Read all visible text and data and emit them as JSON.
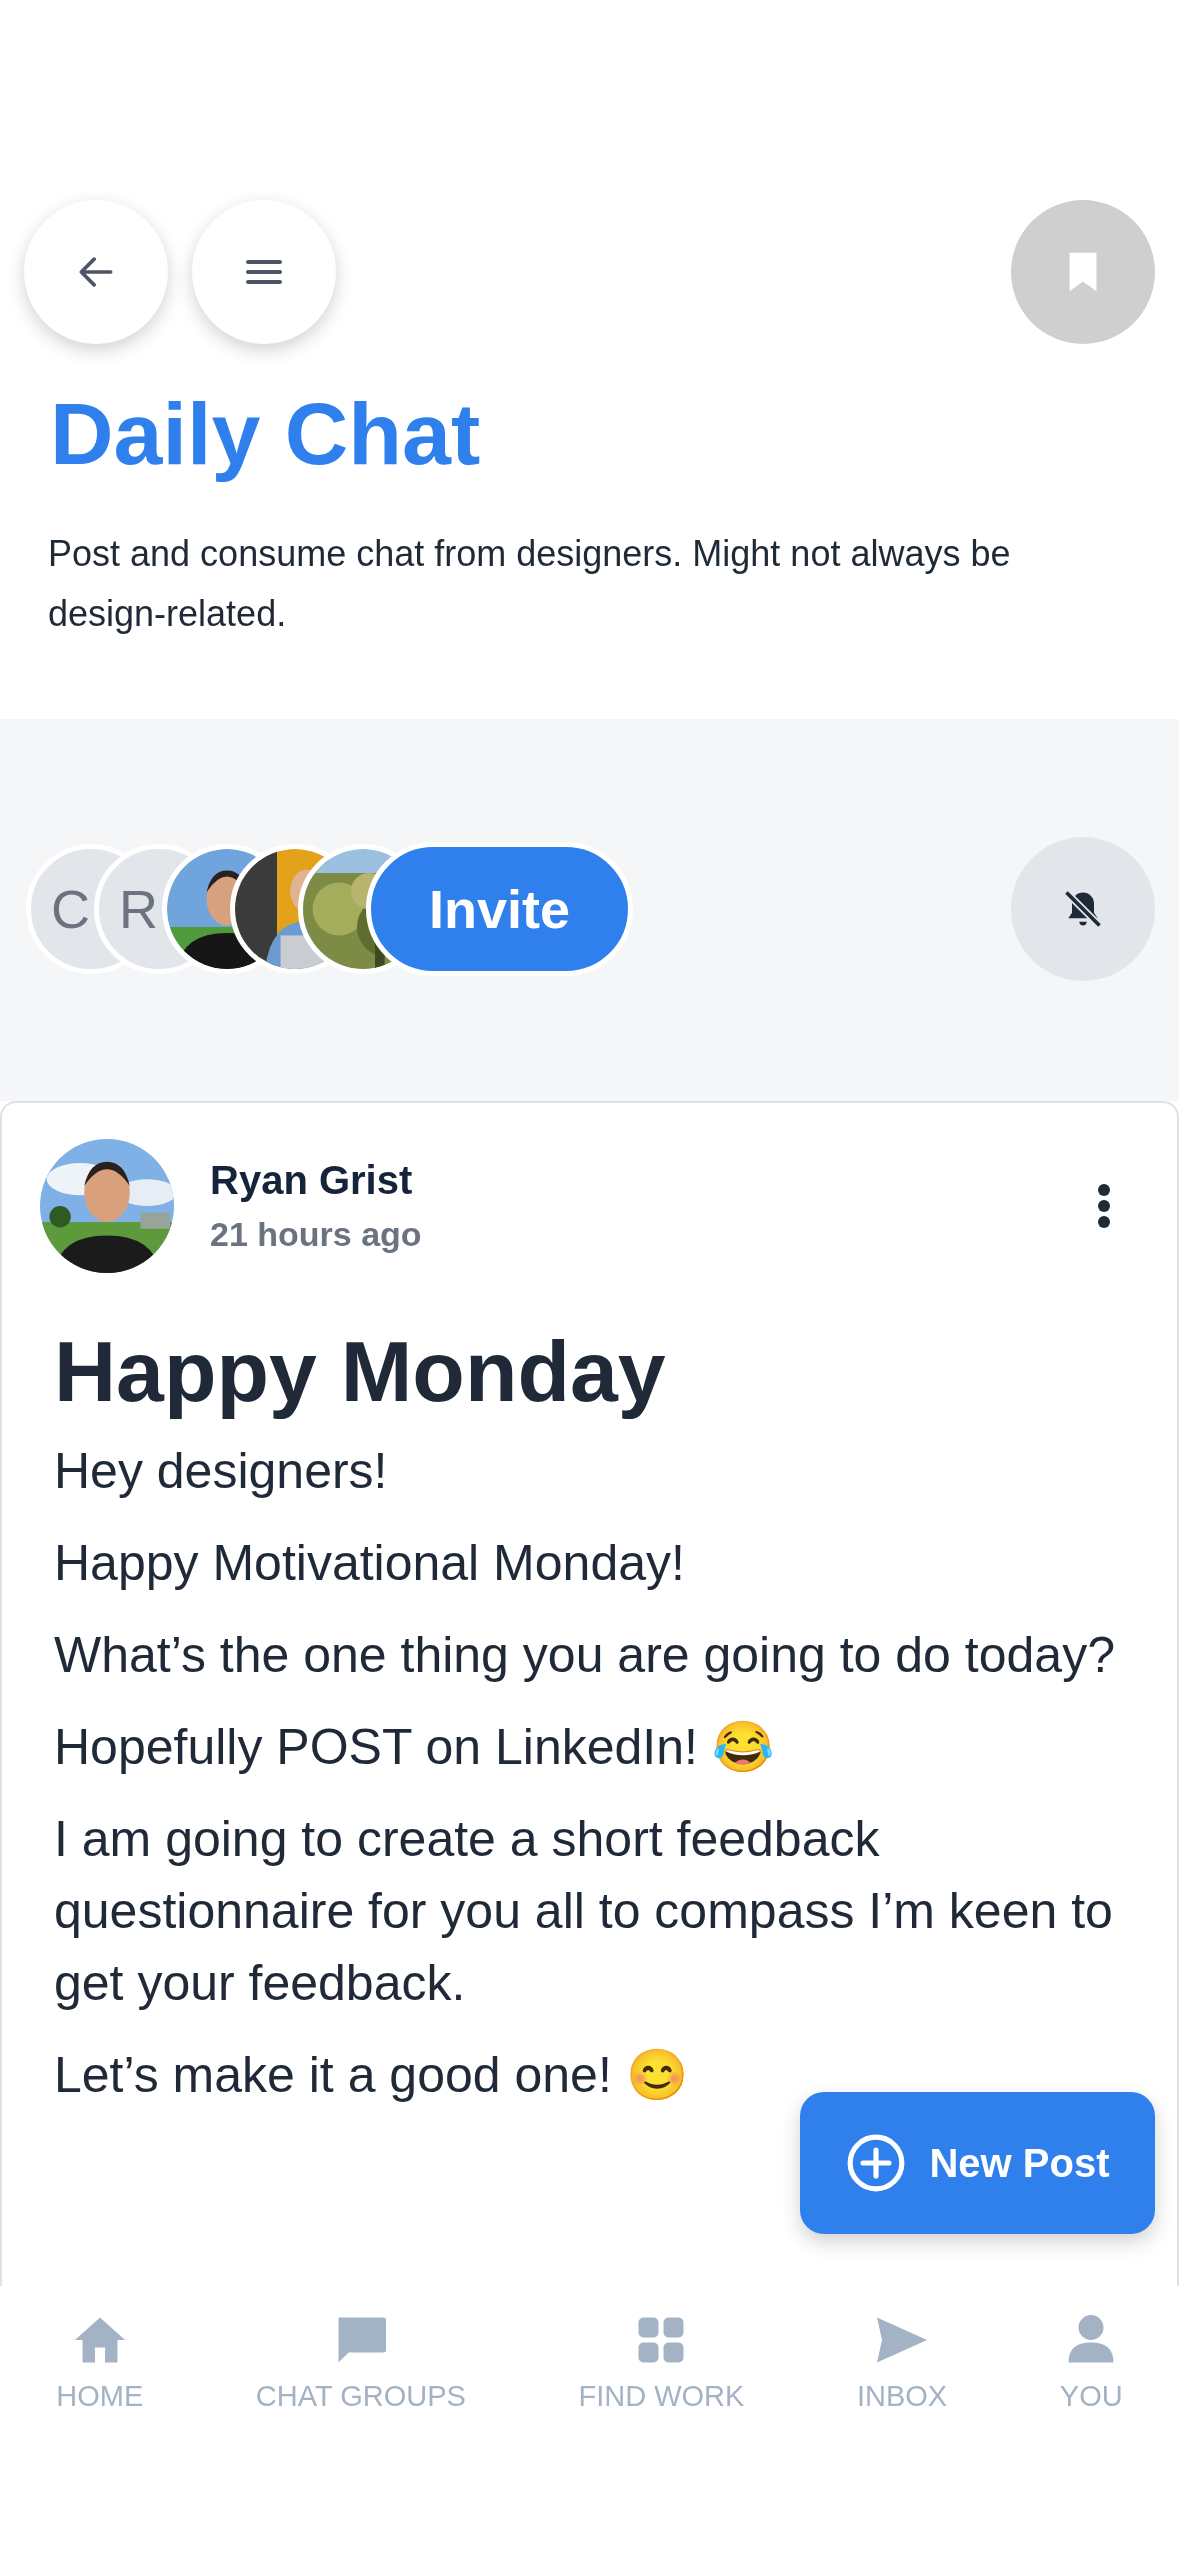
{
  "header": {
    "title": "Daily Chat",
    "description": "Post and consume chat from designers. Might not always be design-related."
  },
  "members": [
    {
      "kind": "initials",
      "text": "C"
    },
    {
      "kind": "initials",
      "text": "R"
    },
    {
      "kind": "picture"
    },
    {
      "kind": "picture"
    },
    {
      "kind": "picture"
    }
  ],
  "invite_button": "Invite",
  "notifications_muted": true,
  "post": {
    "author": "Ryan Grist",
    "time": "21 hours ago",
    "title": "Happy Monday",
    "paragraphs": [
      "Hey designers!",
      "Happy Motivational Monday!",
      "What’s the one thing you are going to do today?",
      "Hopefully POST on LinkedIn! 😂",
      "I am going to create a short feedback questionnaire for you all to compass I’m keen to get your feedback.",
      "Let’s make it a good one! 😊"
    ]
  },
  "new_post_button": "New Post",
  "nav": [
    {
      "kind": "home",
      "label": "HOME",
      "selected": false
    },
    {
      "kind": "chat",
      "label": "CHAT GROUPS",
      "selected": false
    },
    {
      "kind": "grid",
      "label": "FIND WORK",
      "selected": false
    },
    {
      "kind": "send",
      "label": "INBOX",
      "selected": false
    },
    {
      "kind": "person",
      "label": "YOU",
      "selected": false
    }
  ]
}
